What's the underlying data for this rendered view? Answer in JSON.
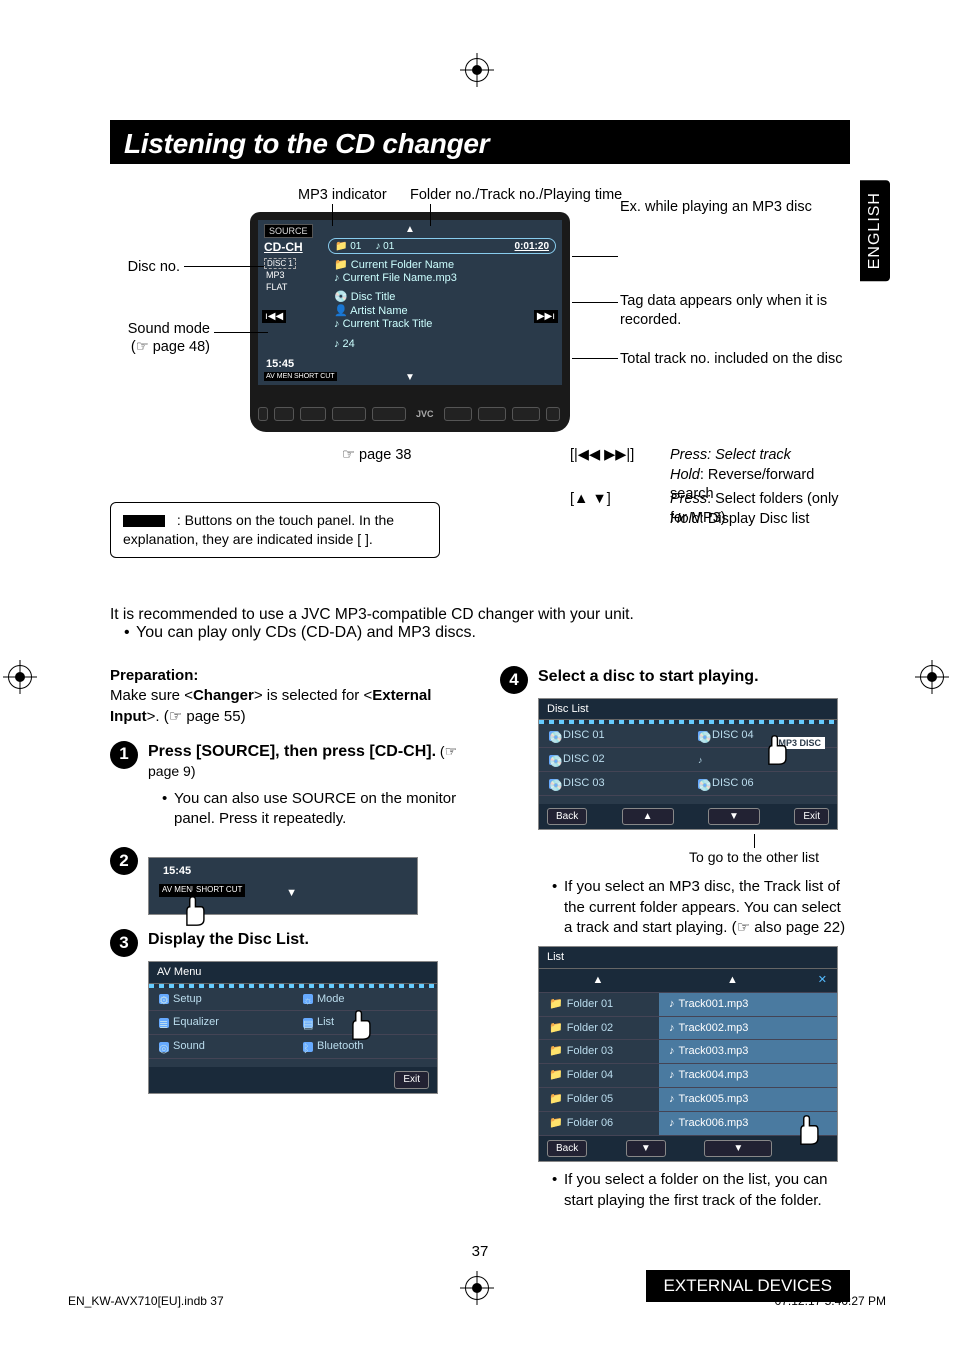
{
  "lang_tab": "ENGLISH",
  "title": "Listening to the CD changer",
  "diagram": {
    "mp3_indicator": "MP3 indicator",
    "folder_track_time": "Folder no./Track no./Playing time",
    "ex_mp3": "Ex. while playing an MP3 disc",
    "disc_no": "Disc no.",
    "sound_mode": "Sound mode",
    "sound_mode_ref": "(☞ page 48)",
    "tag_note": "Tag data appears only when it is recorded.",
    "total_track": "Total track no. included on the disc",
    "page38": "☞ page 38",
    "touch_note": ": Buttons on the touch panel. In the explanation, they are indicated inside [    ].",
    "prev_next_symbol": "[|◀◀ ▶▶|]",
    "prev_next_press": "Press: Select track",
    "prev_next_hold": "Hold: Reverse/forward search",
    "updown_symbol": "[▲ ▼]",
    "updown_press": "Press: Select folders (only for MP3)",
    "updown_hold": "Hold: Display Disc list",
    "screen": {
      "source": "SOURCE",
      "cdch": "CD-CH",
      "folder_num": "📁 01",
      "track_num": "♪ 01",
      "time": "0:01:20",
      "disc1": "DISC 1",
      "mp3": "MP3",
      "flat": "FLAT",
      "folder_name": "Current Folder Name",
      "file_name": "Current File Name.mp3",
      "disc_title": "Disc Title",
      "artist": "Artist Name",
      "track_title": "Current Track Title",
      "total": "♪ 24",
      "clock": "15:45",
      "avmenu": "AV MENU",
      "shortcut": "SHORT CUT",
      "brand": "JVC"
    }
  },
  "intro": {
    "line1": "It is recommended to use a JVC MP3-compatible CD changer with your unit.",
    "bullet1": "You can play only CDs (CD-DA) and MP3 discs."
  },
  "prep": {
    "heading": "Preparation:",
    "text_a": "Make sure <",
    "text_b": "Changer",
    "text_c": "> is selected for <",
    "text_d": "External Input",
    "text_e": ">. (☞ page 55)"
  },
  "step1": {
    "title": "Press [SOURCE], then press [CD-CH].",
    "ref": " (☞ page 9)",
    "bullet": "You can also use SOURCE on the monitor panel. Press it repeatedly."
  },
  "step2": {
    "clock": "15:45",
    "avmenu": "AV MENU",
    "shortcut": "SHORT CUT"
  },
  "step3": {
    "title": "Display the Disc List.",
    "menu": {
      "header": "AV Menu",
      "items": [
        "Setup",
        "Equalizer",
        "Sound",
        "Mode",
        "List",
        "Bluetooth"
      ],
      "exit": "Exit"
    }
  },
  "step4": {
    "title": "Select a disc to start playing.",
    "disc_list": {
      "header": "Disc List",
      "discs": [
        "DISC 01",
        "DISC 02",
        "DISC 03",
        "DISC 04",
        "MP3 DISC",
        "DISC 06"
      ],
      "back": "Back",
      "exit": "Exit"
    },
    "other_list": "To go to the other list",
    "bullet1": "If you select an MP3 disc, the Track list of the current folder appears. You can select a track and start playing. (☞ also page 22)",
    "track_list": {
      "header": "List",
      "folders": [
        "Folder 01",
        "Folder 02",
        "Folder 03",
        "Folder 04",
        "Folder 05",
        "Folder 06"
      ],
      "tracks": [
        "Track001.mp3",
        "Track002.mp3",
        "Track003.mp3",
        "Track004.mp3",
        "Track005.mp3",
        "Track006.mp3"
      ],
      "back": "Back"
    },
    "bullet2": "If you select a folder on the list, you can start playing the first track of the folder."
  },
  "page_number": "37",
  "section_label": "EXTERNAL DEVICES",
  "footer": {
    "file": "EN_KW-AVX710[EU].indb   37",
    "timestamp": "07.12.17   5:46:27 PM"
  }
}
